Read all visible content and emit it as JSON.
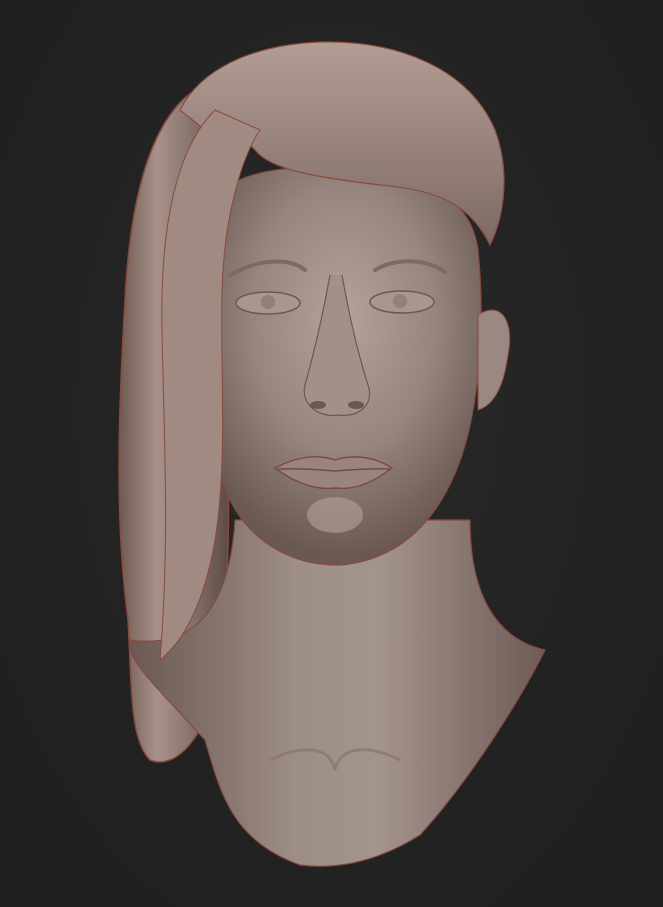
{
  "scene": {
    "subject": "sculpted-bust",
    "background_color": "#232323",
    "material_base_color": "#9b8a83",
    "material_highlight_color": "#c9b8b0",
    "material_shadow_color": "#5e4d47",
    "rim_color": "#a85a4a"
  }
}
